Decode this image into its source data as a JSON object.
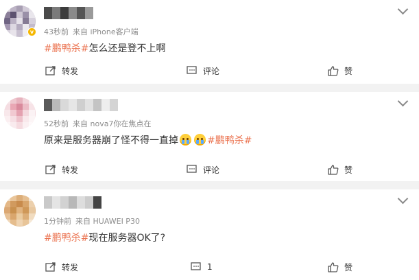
{
  "accent": "#eb7350",
  "posts": [
    {
      "name_visible": "",
      "meta": {
        "time": "43秒前",
        "source": "来自 iPhone客户端"
      },
      "content": {
        "tag": "#鹏鸭杀#",
        "text": "怎么还是登不上啊"
      },
      "actions": {
        "repost": "转发",
        "comment": "评论",
        "like": "赞"
      }
    },
    {
      "name_visible": "",
      "meta": {
        "time": "52秒前",
        "source": "来自 nova7你在焦点在"
      },
      "content": {
        "text": "原来是服务器崩了怪不得一直掉",
        "tag": "#鹏鸭杀#"
      },
      "actions": {
        "repost": "转发",
        "comment": "评论",
        "like": "赞"
      }
    },
    {
      "name_visible": "",
      "meta": {
        "time": "1分钟前",
        "source": "来自 HUAWEI P30"
      },
      "content": {
        "tag": "#鹏鸭杀#",
        "text": "现在服务器OK了?"
      },
      "actions": {
        "repost": "转发",
        "comment": "1",
        "like": "赞"
      }
    }
  ],
  "icons": [
    "repost-icon",
    "comment-icon",
    "like-icon",
    "chevron-down-icon",
    "crying-emoji-icon"
  ]
}
